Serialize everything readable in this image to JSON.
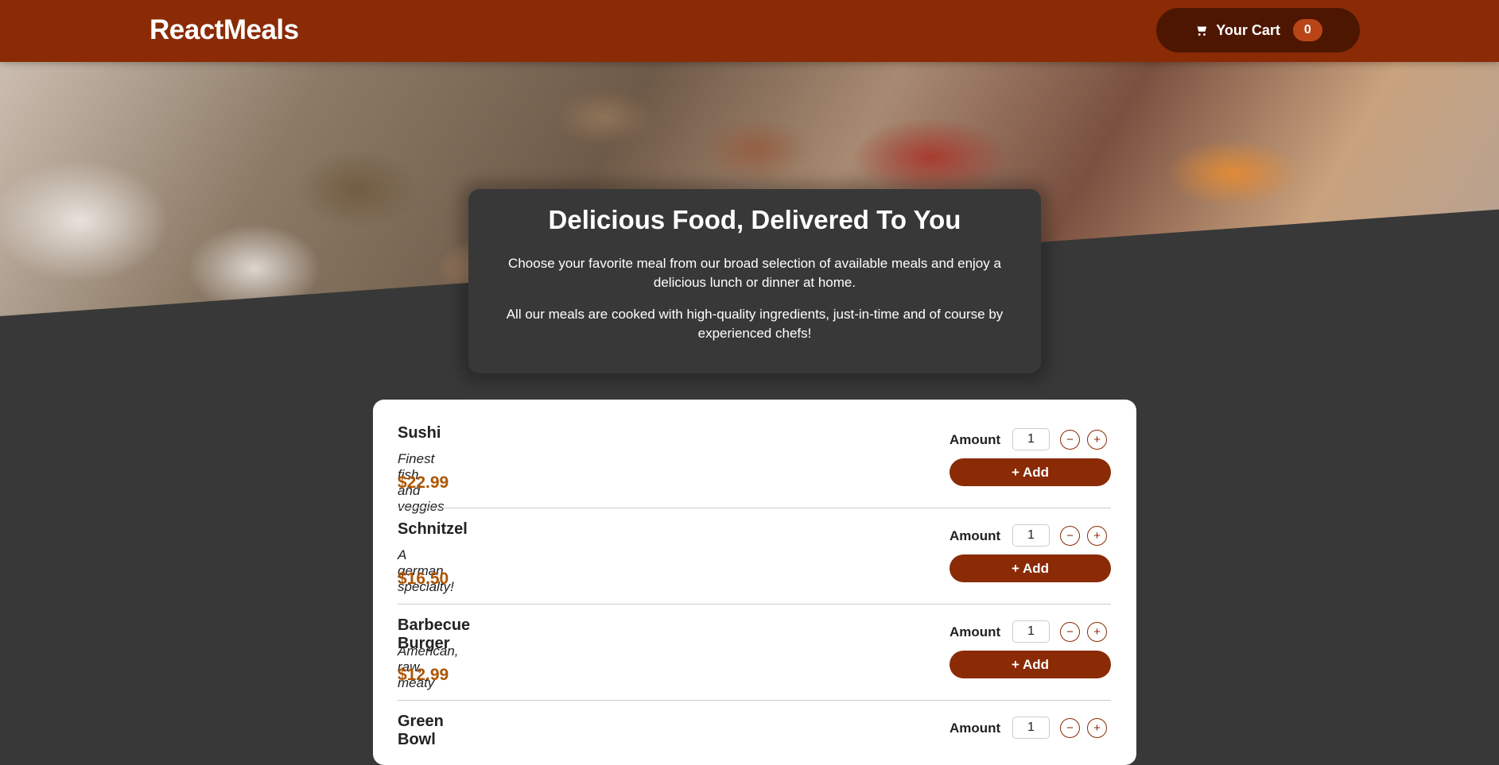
{
  "header": {
    "brand": "ReactMeals",
    "cart_label": "Your Cart",
    "cart_count": "0"
  },
  "summary": {
    "title": "Delicious Food, Delivered To You",
    "paragraph1": "Choose your favorite meal from our broad selection of available meals and enjoy a delicious lunch or dinner at home.",
    "paragraph2": "All our meals are cooked with high-quality ingredients, just-in-time and of course by experienced chefs!"
  },
  "meals": [
    {
      "name": "Sushi",
      "description": "Finest fish and veggies",
      "price": "$22.99",
      "amount": "1"
    },
    {
      "name": "Schnitzel",
      "description": "A german specialty!",
      "price": "$16.50",
      "amount": "1"
    },
    {
      "name": "Barbecue Burger",
      "description": "American, raw, meaty",
      "price": "$12.99",
      "amount": "1"
    },
    {
      "name": "Green Bowl",
      "description": "",
      "price": "",
      "amount": "1"
    }
  ],
  "labels": {
    "amount": "Amount",
    "add": "+ Add",
    "minus": "−",
    "plus": "+"
  },
  "colors": {
    "primary": "#8a2b06",
    "cart_bg": "#4d1601",
    "badge": "#b94517",
    "price": "#ad5502",
    "page_bg": "#383838"
  },
  "icons": {
    "cart": "cart-icon"
  }
}
